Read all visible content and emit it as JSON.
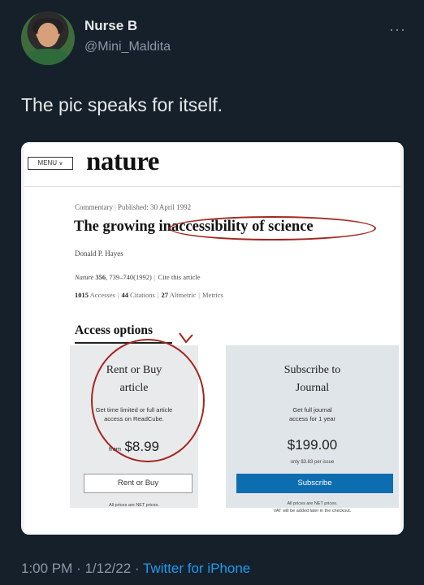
{
  "tweet": {
    "author_name": "Nurse B",
    "handle": "@Mini_Maldita",
    "more_icon": "ellipsis-icon",
    "text": "The pic speaks for itself.",
    "time": "1:00 PM",
    "date": "1/12/22",
    "source": "Twitter for iPhone",
    "colors": {
      "background": "#15202b",
      "link": "#1d9bf0",
      "muted": "#8b98a5"
    }
  },
  "article": {
    "menu_label": "MENU",
    "logo": "nature",
    "type": "Commentary",
    "published": "Published: 30 April 1992",
    "title_part1": "The growing",
    "title_part2": "inaccessibility of science",
    "author": "Donald P. Hayes",
    "journal": "Nature",
    "volume": "356",
    "pages": ", 739–740(1992)",
    "cite_link": "Cite this article",
    "accesses_count": "1015",
    "accesses_label": "Accesses",
    "citations_count": "44",
    "citations_label": "Citations",
    "altmetric_count": "27",
    "altmetric_label": "Altmetric",
    "metrics_link": "Metrics",
    "annotation_color": "#a3261f"
  },
  "access": {
    "heading": "Access options",
    "rent": {
      "title_line1": "Rent or Buy",
      "title_line2": "article",
      "desc_line1": "Get time limited or full article",
      "desc_line2": "access on ReadCube.",
      "from_label": "from",
      "price": "$8.99",
      "button": "Rent or Buy",
      "fine_print": "All prices are NET prices."
    },
    "subscribe": {
      "title_line1": "Subscribe to",
      "title_line2": "Journal",
      "desc_line1": "Get full journal",
      "desc_line2": "access for 1 year",
      "price": "$199.00",
      "price_sub": "only $3.83 per issue",
      "button": "Subscribe",
      "fine_print_line1": "All prices are NET prices.",
      "fine_print_line2": "VAT will be added later in the checkout.",
      "button_color": "#0e6db0"
    }
  }
}
